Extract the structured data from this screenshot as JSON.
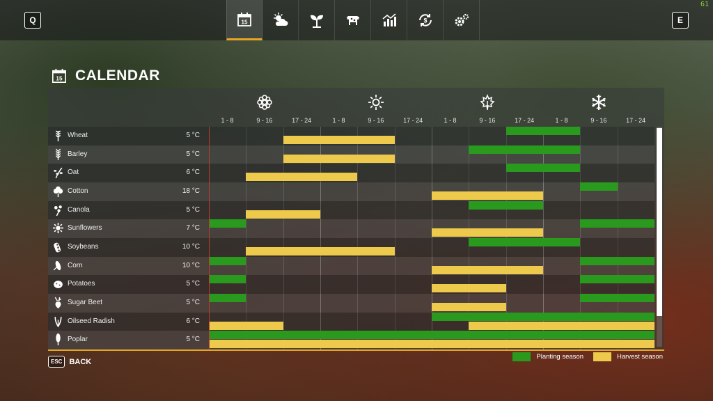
{
  "topbar": {
    "left_key": "Q",
    "right_key": "E",
    "fps": "61",
    "tabs": [
      {
        "icon": "calendar-icon",
        "active": true
      },
      {
        "icon": "weather-icon",
        "active": false
      },
      {
        "icon": "plant-icon",
        "active": false
      },
      {
        "icon": "cow-icon",
        "active": false
      },
      {
        "icon": "stats-chart-icon",
        "active": false
      },
      {
        "icon": "finance-icon",
        "active": false
      },
      {
        "icon": "settings-icon",
        "active": false
      }
    ]
  },
  "page": {
    "title": "CALENDAR",
    "calendar_day": "15"
  },
  "calendar": {
    "seasons": [
      "spring-icon",
      "summer-icon",
      "autumn-icon",
      "winter-icon"
    ],
    "periods": [
      "1 - 8",
      "9 - 16",
      "17 - 24",
      "1 - 8",
      "9 - 16",
      "17 - 24",
      "1 - 8",
      "9 - 16",
      "17 - 24",
      "1 - 8",
      "9 - 16",
      "17 - 24"
    ],
    "crops": [
      {
        "name": "Wheat",
        "temp": "5 °C",
        "icon": "wheat-icon",
        "temp_color": "#f0f0f0",
        "planting": [
          [
            8,
            10
          ]
        ],
        "harvest": [
          [
            2,
            5
          ]
        ]
      },
      {
        "name": "Barley",
        "temp": "5 °C",
        "icon": "barley-icon",
        "temp_color": "#f0f0f0",
        "planting": [
          [
            7,
            10
          ]
        ],
        "harvest": [
          [
            2,
            5
          ]
        ]
      },
      {
        "name": "Oat",
        "temp": "6 °C",
        "icon": "oat-icon",
        "temp_color": "#f0f0f0",
        "planting": [
          [
            8,
            10
          ]
        ],
        "harvest": [
          [
            1,
            4
          ]
        ]
      },
      {
        "name": "Cotton",
        "temp": "18 °C",
        "icon": "cotton-icon",
        "temp_color": "#f0f0f0",
        "planting": [
          [
            10,
            11
          ]
        ],
        "harvest": [
          [
            6,
            9
          ]
        ]
      },
      {
        "name": "Canola",
        "temp": "5 °C",
        "icon": "canola-icon",
        "temp_color": "#f0f0f0",
        "planting": [
          [
            7,
            9
          ]
        ],
        "harvest": [
          [
            1,
            3
          ]
        ]
      },
      {
        "name": "Sunflowers",
        "temp": "7 °C",
        "icon": "sunflower-icon",
        "temp_color": "#f0f0f0",
        "planting": [
          [
            0,
            1
          ],
          [
            10,
            12
          ]
        ],
        "harvest": [
          [
            6,
            9
          ]
        ]
      },
      {
        "name": "Soybeans",
        "temp": "10 °C",
        "icon": "soybean-icon",
        "temp_color": "#f0f0f0",
        "planting": [
          [
            7,
            10
          ]
        ],
        "harvest": [
          [
            1,
            5
          ]
        ]
      },
      {
        "name": "Corn",
        "temp": "10 °C",
        "icon": "corn-icon",
        "temp_color": "#f0f0f0",
        "planting": [
          [
            0,
            1
          ],
          [
            10,
            12
          ]
        ],
        "harvest": [
          [
            6,
            9
          ]
        ]
      },
      {
        "name": "Potatoes",
        "temp": "5 °C",
        "icon": "potato-icon",
        "temp_color": "#f0f0f0",
        "planting": [
          [
            0,
            1
          ],
          [
            10,
            12
          ]
        ],
        "harvest": [
          [
            6,
            8
          ]
        ]
      },
      {
        "name": "Sugar Beet",
        "temp": "5 °C",
        "icon": "sugar-beet-icon",
        "temp_color": "#f0f0f0",
        "planting": [
          [
            0,
            1
          ],
          [
            10,
            12
          ]
        ],
        "harvest": [
          [
            6,
            8
          ]
        ]
      },
      {
        "name": "Oilseed Radish",
        "temp": "6 °C",
        "icon": "oilseed-radish-icon",
        "temp_color": "#f0f0f0",
        "planting": [
          [
            6,
            12
          ]
        ],
        "harvest": [
          [
            0,
            2
          ],
          [
            7,
            12
          ]
        ]
      },
      {
        "name": "Poplar",
        "temp": "5 °C",
        "icon": "poplar-icon",
        "temp_color": "#f0f0f0",
        "planting": [
          [
            0,
            12
          ]
        ],
        "harvest": [
          [
            0,
            12
          ]
        ]
      }
    ]
  },
  "footer": {
    "esc_key": "ESC",
    "back_label": "BACK"
  },
  "legend": {
    "planting_label": "Planting season",
    "harvest_label": "Harvest season"
  },
  "colors": {
    "planting": "#2a9a1e",
    "harvest": "#edc94c",
    "accent": "#e8a722",
    "today_marker": "#c23b2b"
  }
}
